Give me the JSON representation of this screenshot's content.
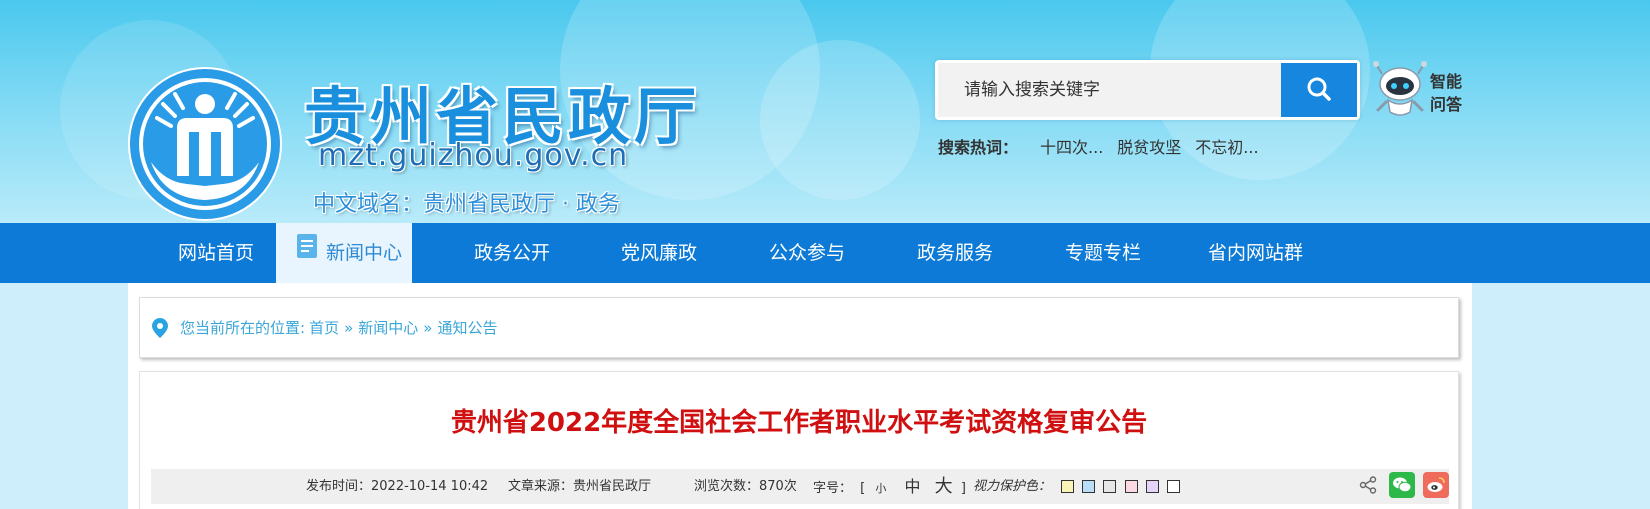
{
  "header": {
    "title": "贵州省民政厅",
    "domain": "mzt.guizhou.gov.cn",
    "cn_domain": "中文域名：贵州省民政厅 · 政务",
    "search": {
      "placeholder": "请输入搜索关键字"
    },
    "assistant_label": "智能问答",
    "hot": {
      "label": "搜索热词：",
      "items": [
        "十四次...",
        "脱贫攻坚",
        "不忘初..."
      ]
    }
  },
  "nav": {
    "items": [
      "网站首页",
      "新闻中心",
      "政务公开",
      "党风廉政",
      "公众参与",
      "政务服务",
      "专题专栏",
      "省内网站群"
    ]
  },
  "breadcrumb": {
    "prefix": "您当前所在的位置:",
    "items": [
      "首页",
      "新闻中心",
      "通知公告"
    ],
    "separator": "»"
  },
  "article": {
    "title": "贵州省2022年度全国社会工作者职业水平考试资格复审公告",
    "meta": {
      "publish_time": "发布时间：2022-10-14 10:42",
      "source": "文章来源：贵州省民政厅",
      "views": "浏览次数：870次",
      "font_size_label": "字号：",
      "font_sizes": [
        "小",
        "中",
        "大"
      ],
      "bracket_open": "[",
      "bracket_close": "]",
      "eye_care_label": "视力保护色：",
      "eye_care_colors": [
        "#faf3b8",
        "#b8def7",
        "#e6e6e6",
        "#fbd9e2",
        "#e5d4f7",
        "#ffffff"
      ]
    }
  },
  "colors": {
    "nav_bg": "#0c7ad6",
    "title_red": "#d01010",
    "link_blue": "#3aa6d8",
    "search_btn": "#1686de"
  }
}
